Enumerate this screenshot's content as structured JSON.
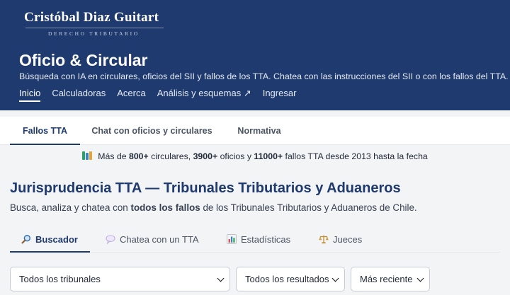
{
  "brand": {
    "name": "Cristóbal Diaz Guitart",
    "subtitle": "DERECHO TRIBUTARIO"
  },
  "site": {
    "title": "Oficio & Circular",
    "description": "Búsqueda con IA en circulares, oficios del SII y fallos de los TTA. Chatea con las instrucciones del SII o con los fallos del TTA."
  },
  "nav": {
    "items": [
      "Inicio",
      "Calculadoras",
      "Acerca",
      "Análisis y esquemas ↗",
      "Ingresar"
    ]
  },
  "tabs": [
    "Fallos TTA",
    "Chat con oficios y circulares",
    "Normativa"
  ],
  "stats": {
    "prefix": "Más de",
    "circulares": "800+",
    "circulares_label": "circulares,",
    "oficios": "3900+",
    "oficios_label": "oficios y",
    "fallos": "11000+",
    "suffix": "fallos TTA desde 2013 hasta la fecha"
  },
  "section": {
    "title": "Jurisprudencia TTA — Tribunales Tributarios y Aduaneros",
    "desc_before": "Busca, analiza y chatea con",
    "desc_bold": "todos los fallos",
    "desc_after": "de los Tribunales Tributarios y Aduaneros de Chile."
  },
  "subtabs": [
    "Buscador",
    "Chatea con un TTA",
    "Estadísticas",
    "Jueces"
  ],
  "filters": {
    "tribunal": "Todos los tribunales",
    "resultado": "Todos los resultados",
    "orden": "Más reciente"
  },
  "icons": {
    "stats": "books-icon",
    "buscador": "magnifier-icon",
    "chat": "speech-bubble-icon",
    "estadisticas": "bar-chart-icon",
    "jueces": "scales-icon"
  },
  "colors": {
    "header_bg": "#1e3a6e",
    "accent": "#1e3a6e",
    "page_bg": "#f3f4f6"
  }
}
